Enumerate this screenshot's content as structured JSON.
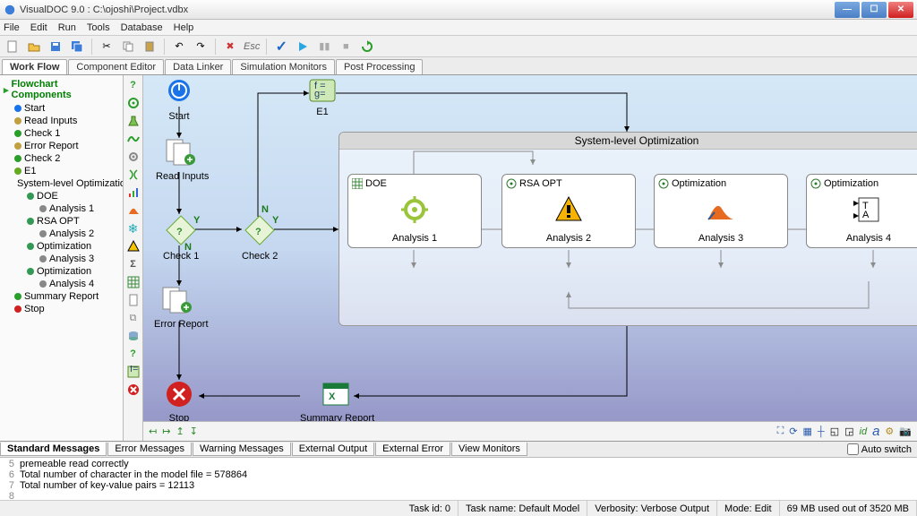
{
  "window": {
    "title": "VisualDOC 9.0 : C:\\ojoshi\\Project.vdbx"
  },
  "menu": [
    "File",
    "Edit",
    "Run",
    "Tools",
    "Database",
    "Help"
  ],
  "tabs": [
    "Work Flow",
    "Component Editor",
    "Data Linker",
    "Simulation Monitors",
    "Post Processing"
  ],
  "tree": {
    "header": "Flowchart Components",
    "items": [
      {
        "label": "Start",
        "lvl": 1,
        "color": "#1a73e8"
      },
      {
        "label": "Read Inputs",
        "lvl": 1,
        "color": "#c0a040"
      },
      {
        "label": "Check 1",
        "lvl": 1,
        "color": "#2a9d2a"
      },
      {
        "label": "Error Report",
        "lvl": 1,
        "color": "#c0a040"
      },
      {
        "label": "Check 2",
        "lvl": 1,
        "color": "#2a9d2a"
      },
      {
        "label": "E1",
        "lvl": 1,
        "color": "#66aa22"
      },
      {
        "label": "System-level Optimization",
        "lvl": 1,
        "color": "#2a9d2a"
      },
      {
        "label": "DOE",
        "lvl": 2,
        "color": "#339955"
      },
      {
        "label": "Analysis 1",
        "lvl": 3,
        "color": "#888"
      },
      {
        "label": "RSA OPT",
        "lvl": 2,
        "color": "#339955"
      },
      {
        "label": "Analysis 2",
        "lvl": 3,
        "color": "#888"
      },
      {
        "label": "Optimization",
        "lvl": 2,
        "color": "#339955"
      },
      {
        "label": "Analysis 3",
        "lvl": 3,
        "color": "#888"
      },
      {
        "label": "Optimization",
        "lvl": 2,
        "color": "#339955"
      },
      {
        "label": "Analysis 4",
        "lvl": 3,
        "color": "#888"
      },
      {
        "label": "Summary Report",
        "lvl": 1,
        "color": "#2a9d2a"
      },
      {
        "label": "Stop",
        "lvl": 1,
        "color": "#d02020"
      }
    ]
  },
  "flow": {
    "start": "Start",
    "read_inputs": "Read Inputs",
    "check1": "Check 1",
    "check2": "Check 2",
    "e1": "E1",
    "error_report": "Error Report",
    "stop": "Stop",
    "summary": "Summary Report",
    "bigbox": "System-level Optimization",
    "yes": "Y",
    "no": "N",
    "doe": {
      "title": "DOE",
      "analysis": "Analysis 1"
    },
    "rsa": {
      "title": "RSA OPT",
      "analysis": "Analysis 2"
    },
    "opt1": {
      "title": "Optimization",
      "analysis": "Analysis 3"
    },
    "opt2": {
      "title": "Optimization",
      "analysis": "Analysis 4"
    }
  },
  "bottom_tabs": [
    "Standard Messages",
    "Error Messages",
    "Warning Messages",
    "External Output",
    "External Error",
    "View Monitors"
  ],
  "auto_switch": "Auto switch",
  "console": [
    {
      "n": "5",
      "t": "premeable read correctly"
    },
    {
      "n": "6",
      "t": "Total number of character in the model file = 578864"
    },
    {
      "n": "7",
      "t": "Total number of key-value pairs = 12113"
    },
    {
      "n": "8",
      "t": ""
    }
  ],
  "status": {
    "task_id": "Task id: 0",
    "task_name": "Task name: Default Model",
    "verbosity": "Verbosity: Verbose Output",
    "mode": "Mode: Edit",
    "mem": "69 MB used out of 3520 MB"
  },
  "esc": "Esc"
}
